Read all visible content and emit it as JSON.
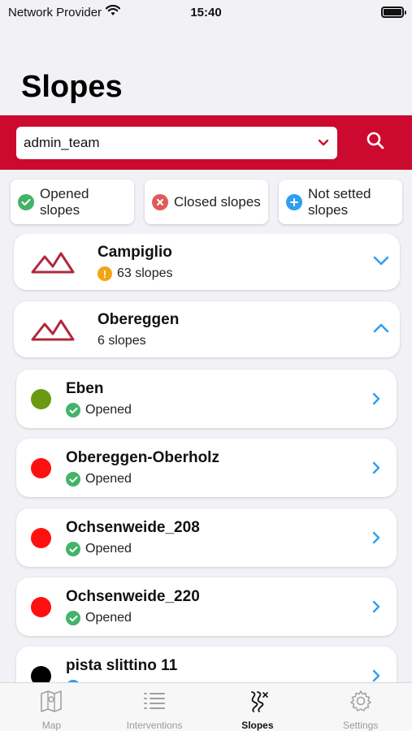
{
  "status_bar": {
    "carrier": "Network Provider",
    "time": "15:40"
  },
  "page": {
    "title": "Slopes"
  },
  "search": {
    "selected_team": "admin_team"
  },
  "filters": [
    {
      "label": "Opened slopes",
      "color": "#43b36a"
    },
    {
      "label": "Closed slopes",
      "color": "#e05a5a"
    },
    {
      "label": "Not setted slopes",
      "color": "#2f9ff0"
    }
  ],
  "areas": [
    {
      "name": "Campiglio",
      "count": "63 slopes",
      "warning": true,
      "expanded": false
    },
    {
      "name": "Obereggen",
      "count": "6 slopes",
      "warning": false,
      "expanded": true
    }
  ],
  "slopes": [
    {
      "name": "Eben",
      "status": "Opened",
      "color": "#6a9a12"
    },
    {
      "name": "Obereggen-Oberholz",
      "status": "Opened",
      "color": "#ff1010"
    },
    {
      "name": "Ochsenweide_208",
      "status": "Opened",
      "color": "#ff1010"
    },
    {
      "name": "Ochsenweide_220",
      "status": "Opened",
      "color": "#ff1010"
    },
    {
      "name": "pista slittino 11",
      "status": "",
      "color": "#000000"
    }
  ],
  "tabs": [
    {
      "label": "Map",
      "icon": "map-icon",
      "active": false
    },
    {
      "label": "Interventions",
      "icon": "list-icon",
      "active": false
    },
    {
      "label": "Slopes",
      "icon": "slopes-icon",
      "active": true
    },
    {
      "label": "Settings",
      "icon": "gear-icon",
      "active": false
    }
  ],
  "colors": {
    "brand_red": "#cc0a2f",
    "accent_blue": "#2f9ff0",
    "mountain": "#b0283a"
  }
}
